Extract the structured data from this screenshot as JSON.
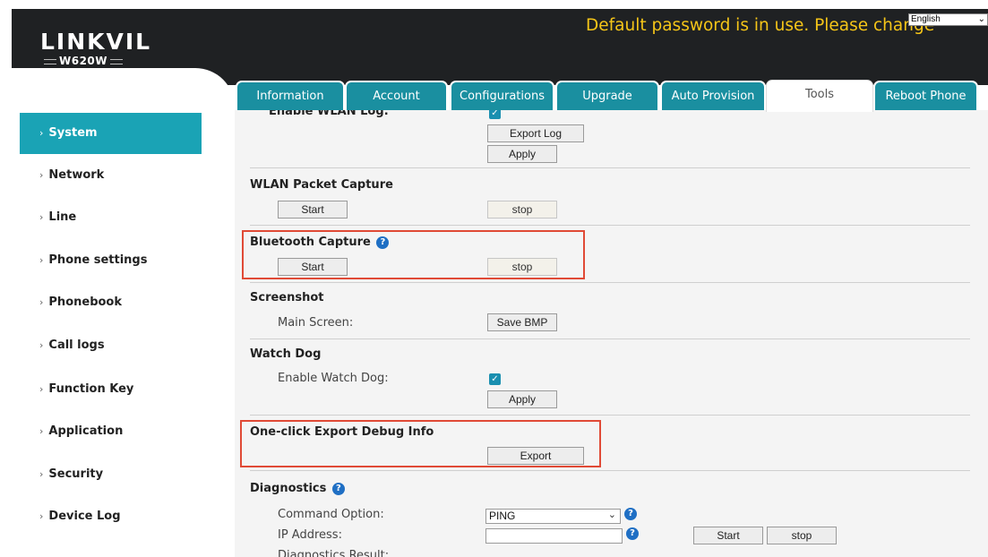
{
  "header": {
    "logo": "LINKVIL",
    "model": "W620W",
    "warning": "Default password is in use. Please change",
    "language": "English"
  },
  "tabs": [
    {
      "label": "Information"
    },
    {
      "label": "Account"
    },
    {
      "label": "Configurations"
    },
    {
      "label": "Upgrade"
    },
    {
      "label": "Auto Provision"
    },
    {
      "label": "Tools",
      "active": true
    },
    {
      "label": "Reboot Phone"
    }
  ],
  "sidebar": {
    "items": [
      {
        "label": "System",
        "active": true
      },
      {
        "label": "Network"
      },
      {
        "label": "Line"
      },
      {
        "label": "Phone settings"
      },
      {
        "label": "Phonebook"
      },
      {
        "label": "Call logs"
      },
      {
        "label": "Function Key"
      },
      {
        "label": "Application"
      },
      {
        "label": "Security"
      },
      {
        "label": "Device Log"
      }
    ]
  },
  "main": {
    "wlan_log": {
      "title": "Enable WLAN Log:",
      "checked": true,
      "export_label": "Export Log",
      "apply_label": "Apply"
    },
    "wlan_capture": {
      "title": "WLAN Packet Capture",
      "start_label": "Start",
      "stop_label": "stop"
    },
    "bluetooth_capture": {
      "title": "Bluetooth Capture",
      "start_label": "Start",
      "stop_label": "stop"
    },
    "screenshot": {
      "title": "Screenshot",
      "main_screen_label": "Main Screen:",
      "save_label": "Save BMP"
    },
    "watchdog": {
      "title": "Watch Dog",
      "enable_label": "Enable Watch Dog:",
      "checked": true,
      "apply_label": "Apply"
    },
    "export_debug": {
      "title": "One-click Export Debug Info",
      "export_label": "Export"
    },
    "diagnostics": {
      "title": "Diagnostics",
      "command_label": "Command Option:",
      "command_value": "PING",
      "ip_label": "IP Address:",
      "ip_value": "",
      "start_label": "Start",
      "stop_label": "stop",
      "result_label": "Diagnostics Result:"
    }
  },
  "colors": {
    "header_bg": "#1f2123",
    "accent": "#1aa3b5",
    "tab_bg": "#1a8fa0",
    "warning": "#f5c518",
    "highlight": "#e04a36",
    "help_icon": "#1f6fc4"
  }
}
